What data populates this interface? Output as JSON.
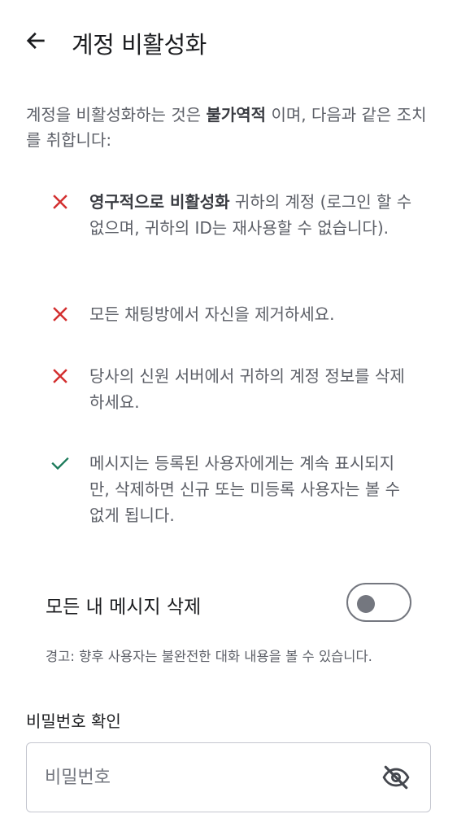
{
  "header": {
    "title": "계정 비활성화",
    "back_icon": "arrow-left-icon"
  },
  "intro": {
    "before": "계정을 비활성화하는 것은 ",
    "bold": "불가역적",
    "after": " 이며, 다음과 같은 조치를 취합니다:"
  },
  "consequences": [
    {
      "icon": "x-icon",
      "color": "#d32f2f",
      "bold": "영구적으로 비활성화",
      "text": " 귀하의 계정 (로그인 할 수 없으며, 귀하의 ID는 재사용할 수 없습니다)."
    },
    {
      "icon": "x-icon",
      "color": "#d32f2f",
      "bold": "",
      "text": "모든 채팅방에서 자신을 제거하세요."
    },
    {
      "icon": "x-icon",
      "color": "#d32f2f",
      "bold": "",
      "text": "당사의 신원 서버에서 귀하의 계정 정보를 삭제하세요."
    },
    {
      "icon": "check-icon",
      "color": "#1b7a5a",
      "bold": "",
      "text": "메시지는 등록된 사용자에게는 계속 표시되지만, 삭제하면 신규 또는 미등록 사용자는 볼 수 없게 됩니다."
    }
  ],
  "delete_messages": {
    "label": "모든 내 메시지 삭제",
    "enabled": false
  },
  "warning": "경고: 향후 사용자는 불완전한 대화 내용을 볼 수 있습니다.",
  "password": {
    "label": "비밀번호 확인",
    "placeholder": "비밀번호",
    "value": "",
    "visibility_icon": "eye-off-icon"
  },
  "colors": {
    "danger": "#d32f2f",
    "success": "#1b7a5a",
    "text_primary": "#1b1c1f",
    "text_secondary": "#5b5e66",
    "outline": "#74777f"
  }
}
